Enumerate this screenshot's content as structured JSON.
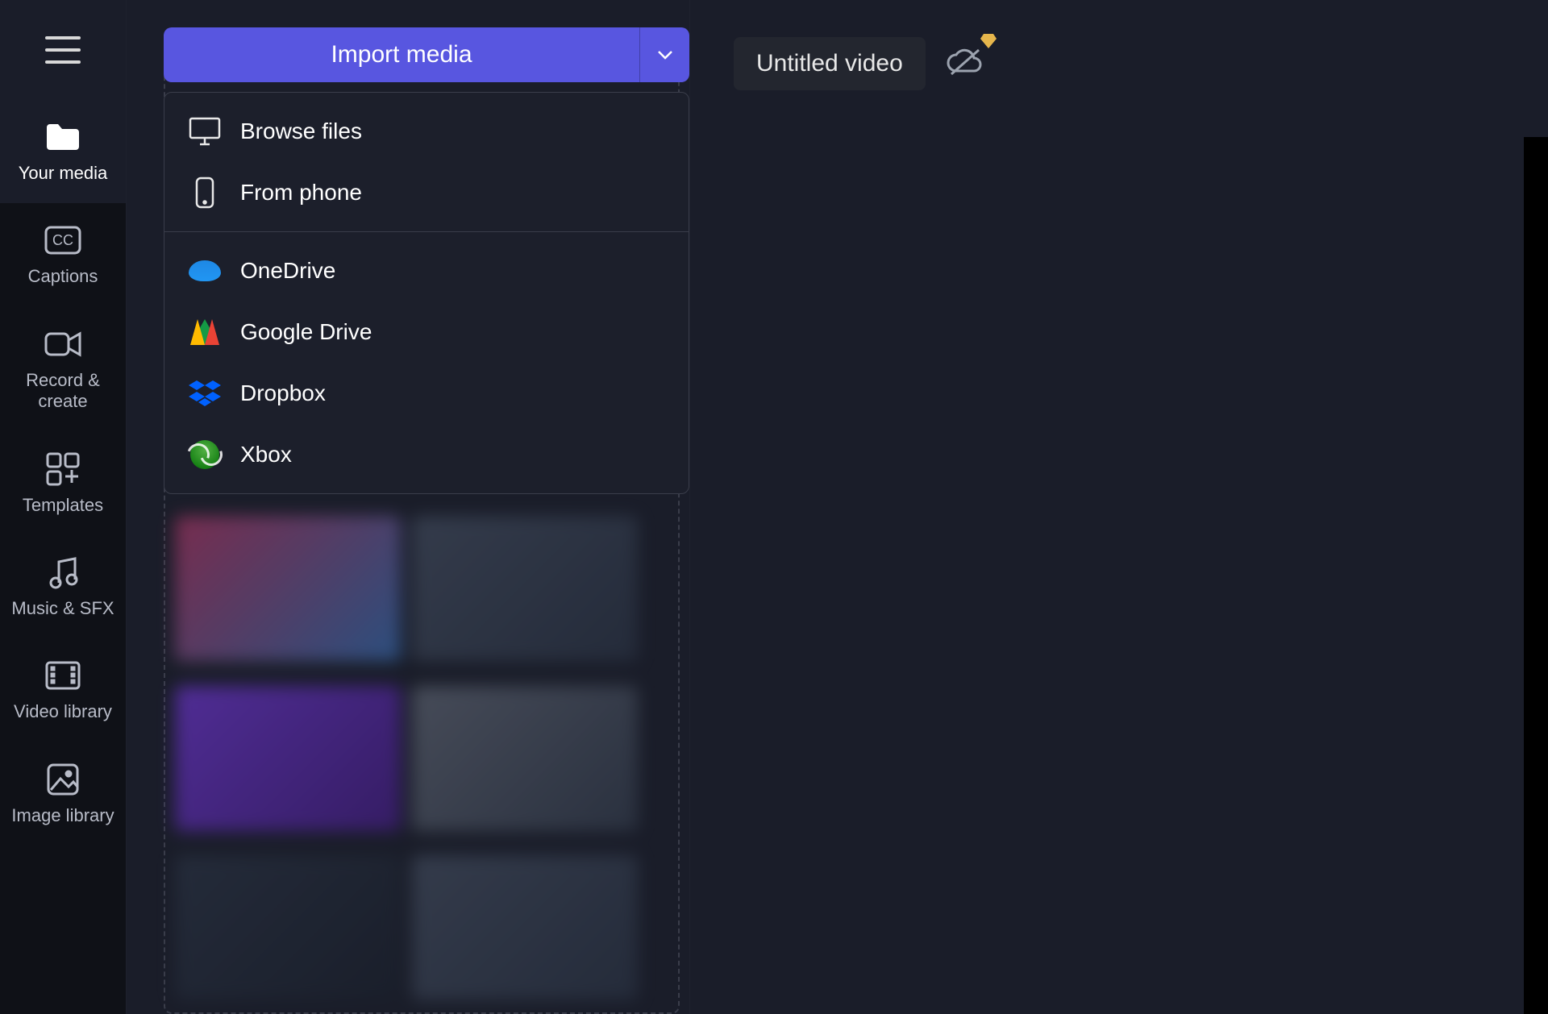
{
  "sidebar": {
    "items": [
      {
        "label": "Your media"
      },
      {
        "label": "Captions"
      },
      {
        "label": "Record & create"
      },
      {
        "label": "Templates"
      },
      {
        "label": "Music & SFX"
      },
      {
        "label": "Video library"
      },
      {
        "label": "Image library"
      }
    ]
  },
  "import": {
    "button_label": "Import media",
    "menu_groups": [
      {
        "items": [
          {
            "icon": "monitor-icon",
            "label": "Browse files"
          },
          {
            "icon": "phone-icon",
            "label": "From phone"
          }
        ]
      },
      {
        "items": [
          {
            "icon": "onedrive-icon",
            "label": "OneDrive"
          },
          {
            "icon": "google-drive-icon",
            "label": "Google Drive"
          },
          {
            "icon": "dropbox-icon",
            "label": "Dropbox"
          },
          {
            "icon": "xbox-icon",
            "label": "Xbox"
          }
        ]
      }
    ]
  },
  "project": {
    "title": "Untitled video"
  },
  "colors": {
    "accent": "#5856e0",
    "bg_dark": "#0f1117",
    "bg_panel": "#1a1d29",
    "premium_badge": "#e6b64c"
  }
}
